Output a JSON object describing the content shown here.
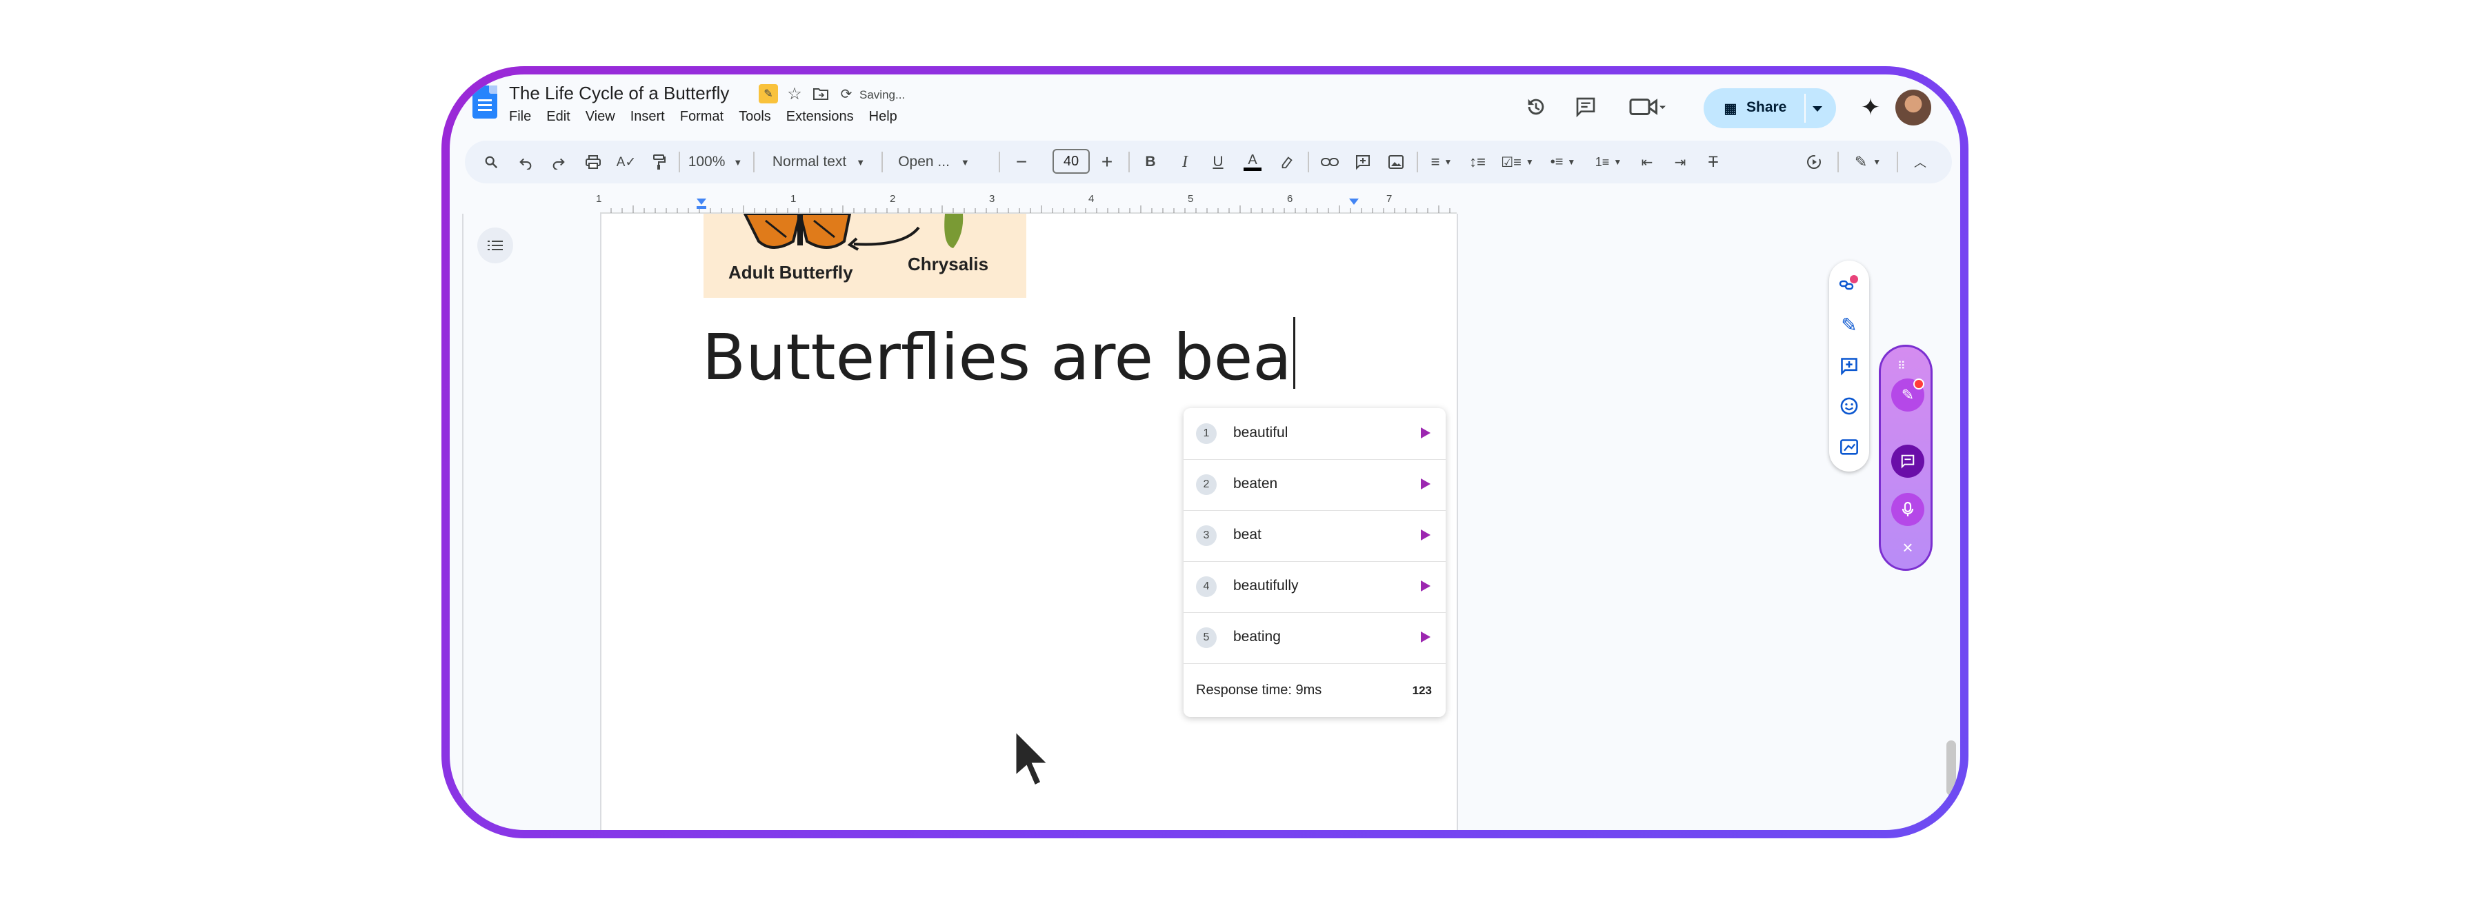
{
  "doc": {
    "title": "The Life Cycle of a Butterfly",
    "saving_status": "Saving..."
  },
  "menu": [
    "File",
    "Edit",
    "View",
    "Insert",
    "Format",
    "Tools",
    "Extensions",
    "Help"
  ],
  "share": {
    "label": "Share"
  },
  "toolbar": {
    "zoom": "100%",
    "style": "Normal text",
    "font": "Open ...",
    "font_size": "40"
  },
  "ruler": {
    "numbers": [
      "1",
      "1",
      "2",
      "3",
      "4",
      "5",
      "6",
      "7"
    ]
  },
  "image": {
    "label_left": "Adult Butterfly",
    "label_right": "Chrysalis"
  },
  "editor": {
    "text": "Butterflies are bea"
  },
  "suggestions": {
    "items": [
      {
        "num": "1",
        "word": "beautiful"
      },
      {
        "num": "2",
        "word": "beaten"
      },
      {
        "num": "3",
        "word": "beat"
      },
      {
        "num": "4",
        "word": "beautifully"
      },
      {
        "num": "5",
        "word": "beating"
      }
    ],
    "response_time": "Response time: 9ms",
    "mode_icon": "123"
  },
  "colors": {
    "frame": "#8e2fe0",
    "share_bg": "#c2e7ff",
    "accent": "#9c27b0"
  }
}
